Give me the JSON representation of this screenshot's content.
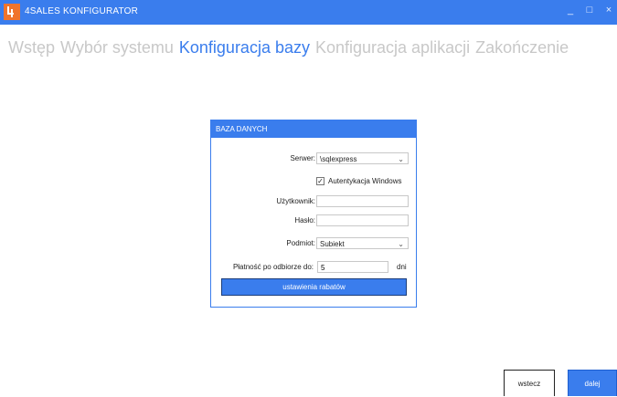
{
  "window": {
    "title": "4SALES KONFIGURATOR",
    "icon": "app-logo-icon",
    "controls": [
      "_",
      "□",
      "×"
    ]
  },
  "wizard_steps": [
    {
      "label": "Wstęp",
      "active": false
    },
    {
      "label": "Wybór systemu",
      "active": false
    },
    {
      "label": "Konfiguracja bazy",
      "active": true
    },
    {
      "label": "Konfiguracja aplikacji",
      "active": false
    },
    {
      "label": "Zakończenie",
      "active": false
    }
  ],
  "panel": {
    "header": "BAZA DANYCH",
    "server": {
      "label": "Serwer:",
      "value": "\\sqlexpress"
    },
    "windows_auth": {
      "label": "Autentykacja Windows",
      "checked": true
    },
    "user": {
      "label": "Użytkownik:",
      "value": ""
    },
    "password": {
      "label": "Hasło:",
      "value": ""
    },
    "entity": {
      "label": "Podmiot:",
      "value": "Subiekt"
    },
    "payment": {
      "label": "Płatność po odbiorze do:",
      "value": "5",
      "unit": "dni"
    },
    "discount_button": "ustawienia rabatów"
  },
  "footer": {
    "back": "wstecz",
    "next": "dalej"
  },
  "colors": {
    "accent": "#3a7ded",
    "inactive_step": "#c8c8c8"
  }
}
